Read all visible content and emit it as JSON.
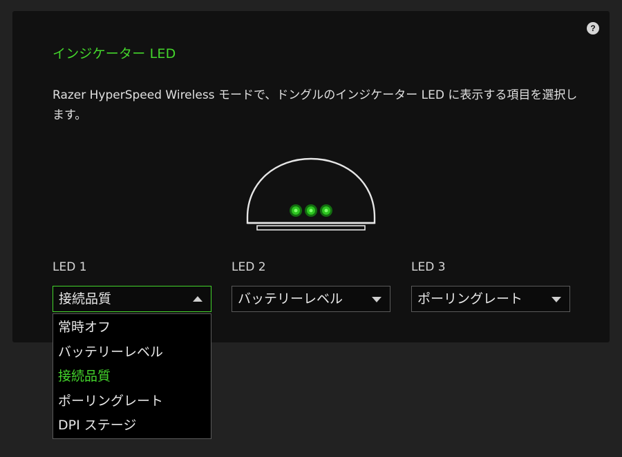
{
  "panel": {
    "help_label": "?",
    "title": "インジケーター LED",
    "description": "Razer HyperSpeed Wireless モードで、ドングルのインジケーター LED に表示する項目を選択します。"
  },
  "leds": [
    {
      "label": "LED 1",
      "value": "接続品質",
      "open": true
    },
    {
      "label": "LED 2",
      "value": "バッテリーレベル",
      "open": false
    },
    {
      "label": "LED 3",
      "value": "ポーリングレート",
      "open": false
    }
  ],
  "dropdown": {
    "options": [
      "常時オフ",
      "バッテリーレベル",
      "接続品質",
      "ポーリングレート",
      "DPI ステージ"
    ],
    "selected": "接続品質"
  },
  "colors": {
    "accent": "#44d62c",
    "panel_bg": "#111111",
    "page_bg": "#222222",
    "led_glow": "#1fa51a"
  },
  "icons": {
    "help": "question-circle-icon",
    "dropdown_open": "triangle-up-icon",
    "dropdown_closed": "triangle-down-icon",
    "dongle": "dongle-illustration"
  }
}
